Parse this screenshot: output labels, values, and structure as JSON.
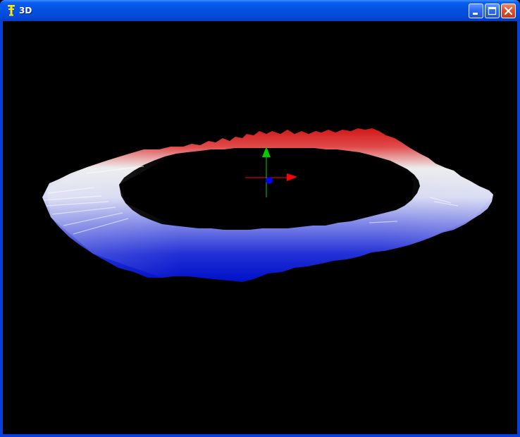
{
  "window": {
    "title": "3D",
    "app_icon": "app-icon-yellow",
    "controls": {
      "minimize_icon": "minimize-icon",
      "maximize_icon": "maximize-icon",
      "close_icon": "close-icon"
    }
  },
  "scene": {
    "background_color": "#000000",
    "object": "ring-surface",
    "gradient_colors": {
      "far": "#d01818",
      "middle": "#e8e8e8",
      "near": "#0010c8"
    },
    "axes": {
      "x_color": "#ff0000",
      "y_color": "#00cc00",
      "z_color": "#0000ff"
    }
  }
}
